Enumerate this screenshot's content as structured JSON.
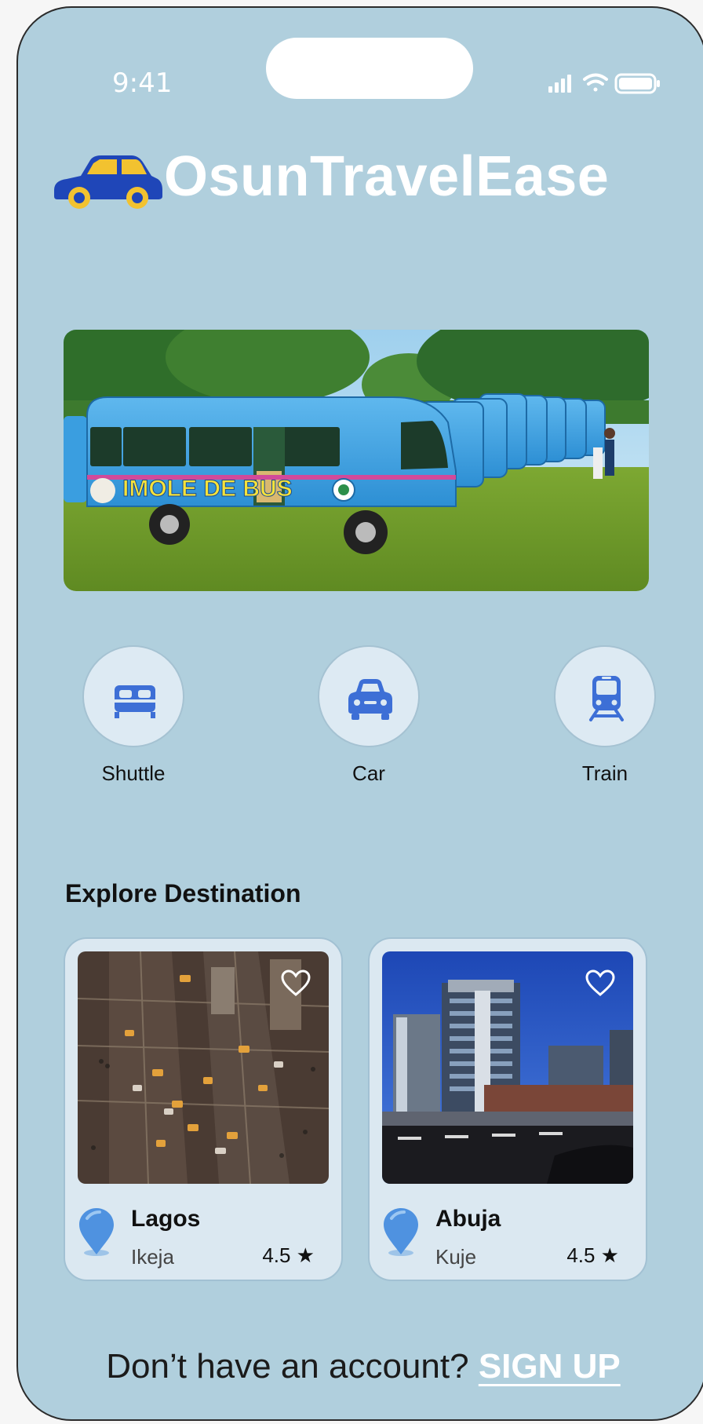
{
  "status_bar": {
    "time": "9:41"
  },
  "brand": {
    "name": "OsunTravelEase"
  },
  "hero": {
    "bus_text": "IMOLE DE BUS"
  },
  "categories": [
    {
      "label": "Shuttle",
      "icon": "bed-icon"
    },
    {
      "label": "Car",
      "icon": "car-icon"
    },
    {
      "label": "Train",
      "icon": "train-icon"
    }
  ],
  "explore": {
    "title": "Explore Destination",
    "cards": [
      {
        "city": "Lagos",
        "area": "Ikeja",
        "rating": "4.5 ★"
      },
      {
        "city": "Abuja",
        "area": "Kuje",
        "rating": "4.5 ★"
      }
    ]
  },
  "footer": {
    "prompt": "Don’t have an account?",
    "signup_label": "SIGN UP"
  },
  "colors": {
    "background": "#b0cfdd",
    "accent": "#3d6fd6",
    "brand_car": "#1f46b8",
    "card": "#dbe8f1"
  }
}
